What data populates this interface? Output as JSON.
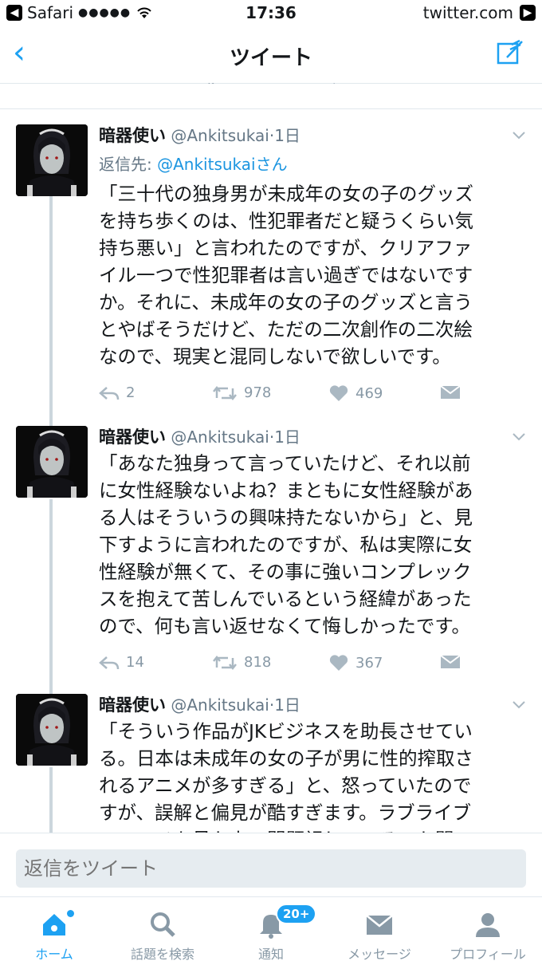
{
  "status_bar": {
    "back_app": "Safari",
    "signal": "●●●●●",
    "time": "17:36",
    "url": "twitter.com"
  },
  "nav": {
    "title": "ツイート"
  },
  "tweets": [
    {
      "name": "暗器使い",
      "handle": "@Ankitsukai",
      "dot": "·",
      "time": "1日",
      "reply_label": "返信先:",
      "reply_mention": "@Ankitsukaiさん",
      "text": "「三十代の独身男が未成年の女の子のグッズ\nを持ち歩くのは、性犯罪者だと疑うくらい気\n持ち悪い」と言われたのですが、クリアファ\nイル一つで性犯罪者は言い過ぎではないです\nか。それに、未成年の女の子のグッズと言う\nとやばそうだけど、ただの二次創作の二次絵\nなので、現実と混同しないで欲しいです。",
      "replies": "2",
      "retweets": "978",
      "likes": "469"
    },
    {
      "name": "暗器使い",
      "handle": "@Ankitsukai",
      "dot": "·",
      "time": "1日",
      "text": "「あなた独身って言っていたけど、それ以前\nに女性経験ないよね？まともに女性経験があ\nる人はそういうの興味持たないから」と、見\n下すように言われたのですが、私は実際に女\n性経験が無くて、その事に強いコンプレック\nスを抱えて苦しんでいるという経緯があった\nので、何も言い返せなくて悔しかったです。",
      "replies": "14",
      "retweets": "818",
      "likes": "367"
    },
    {
      "name": "暗器使い",
      "handle": "@Ankitsukai",
      "dot": "·",
      "time": "1日",
      "text": "「そういう作品がJKビジネスを助長させてい\nる。日本は未成年の女の子が男に性的搾取さ\nれるアニメが多すぎる」と、怒っていたので\nすが、誤解と偏見が酷すぎます。ラブライブ\nのアニメを見た上で問題視しているのか聞い"
    }
  ],
  "reply_box": {
    "placeholder": "返信をツイート"
  },
  "tabs": [
    {
      "label": "ホーム",
      "icon": "home-icon"
    },
    {
      "label": "話題を検索",
      "icon": "search-icon"
    },
    {
      "label": "通知",
      "icon": "bell-icon",
      "badge": "20+"
    },
    {
      "label": "メッセージ",
      "icon": "envelope-icon"
    },
    {
      "label": "プロフィール",
      "icon": "person-icon"
    }
  ],
  "colors": {
    "accent": "#1da1f2",
    "mention": "#1b95e0",
    "muted": "#8899a6"
  }
}
